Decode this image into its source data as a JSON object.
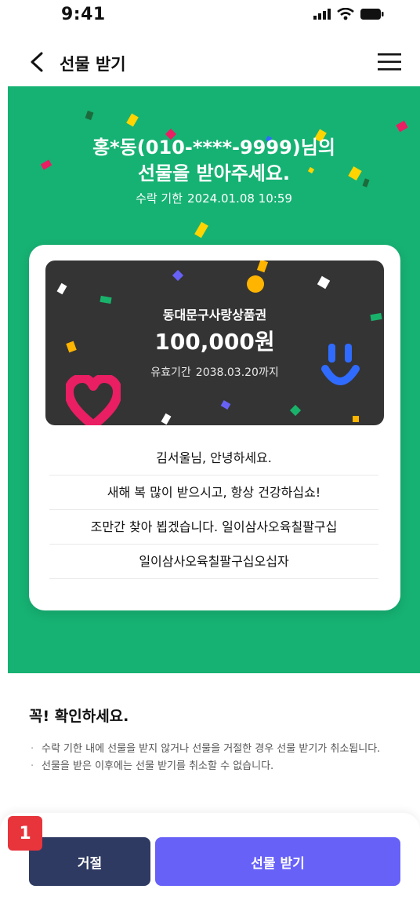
{
  "status_bar": {
    "time": "9:41"
  },
  "nav": {
    "title": "선물 받기"
  },
  "hero": {
    "title_line1": "홍*동(010-****-9999)님의",
    "title_line2": "선물을 받아주세요.",
    "deadline_label": "수락 기한",
    "deadline_value": "2024.01.08 10:59",
    "background_color": "#16b273"
  },
  "voucher": {
    "name": "동대문구사랑상품권",
    "amount": "100,000원",
    "validity_label": "유효기간",
    "validity_value": "2038.03.20까지"
  },
  "message": [
    "김서울님, 안녕하세요.",
    "새해 복 많이 받으시고, 항상 건강하십쇼!",
    "조만간 찾아 뵙겠습니다. 일이삼사오육칠팔구십",
    "일이삼사오육칠팔구십오십자"
  ],
  "notice": {
    "title": "꼭! 확인하세요.",
    "items": [
      "수락 기한 내에 선물을 받지 않거나 선물을 거절한 경우 선물 받기가 취소됩니다.",
      "선물을 받은 이후에는 선물 받기를 취소할 수 없습니다."
    ]
  },
  "actions": {
    "reject_label": "거절",
    "accept_label": "선물 받기",
    "reject_color": "#2e3a62",
    "accept_color": "#6761f8"
  },
  "step_badge": "1",
  "icons": [
    "cellular-signal-icon",
    "wifi-icon",
    "battery-icon",
    "back-arrow-icon",
    "hamburger-menu-icon",
    "heart-icon",
    "smiley-icon"
  ]
}
